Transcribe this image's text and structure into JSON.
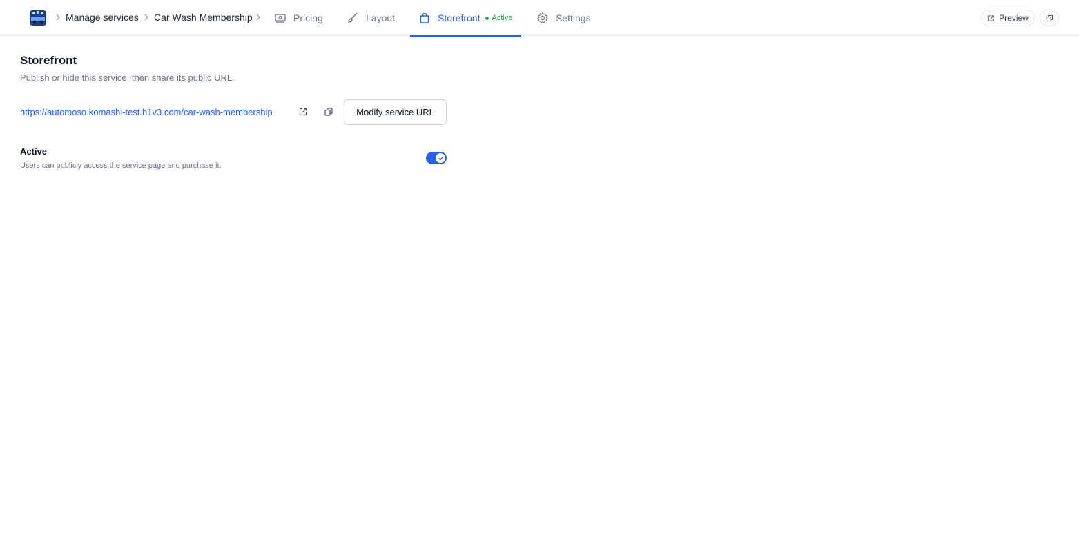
{
  "header": {
    "logo_icon": "car-wash-logo-icon",
    "breadcrumbs": [
      "Manage services",
      "Car Wash Membership"
    ],
    "tabs": [
      {
        "label": "Pricing",
        "icon": "money-icon"
      },
      {
        "label": "Layout",
        "icon": "brush-icon"
      },
      {
        "label": "Storefront",
        "icon": "shopping-bag-icon",
        "badge": "Active",
        "active": true
      },
      {
        "label": "Settings",
        "icon": "gear-icon"
      }
    ],
    "preview_label": "Preview"
  },
  "storefront": {
    "title": "Storefront",
    "subtitle": "Publish or hide this service, then share its public URL.",
    "url": "https://automoso.komashi-test.h1v3.com/car-wash-membership",
    "modify_label": "Modify service URL",
    "active_label": "Active",
    "active_description": "Users can publicly access the service page and purchase it.",
    "active_enabled": true
  },
  "colors": {
    "accent": "#2563eb",
    "success": "#16a34a",
    "muted": "#6b7280"
  }
}
